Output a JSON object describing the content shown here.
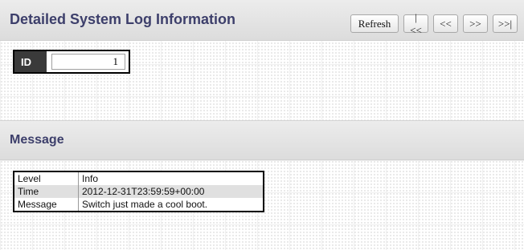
{
  "header": {
    "title": "Detailed System Log Information",
    "buttons": {
      "refresh": "Refresh",
      "first": "|<<",
      "prev": "<<",
      "next": ">>",
      "last": ">>|"
    }
  },
  "id_field": {
    "label": "ID",
    "value": "1"
  },
  "message_section": {
    "title": "Message",
    "rows": [
      {
        "label": "Level",
        "value": "Info"
      },
      {
        "label": "Time",
        "value": "2012-12-31T23:59:59+00:00"
      },
      {
        "label": "Message",
        "value": "Switch just made a cool boot."
      }
    ]
  }
}
